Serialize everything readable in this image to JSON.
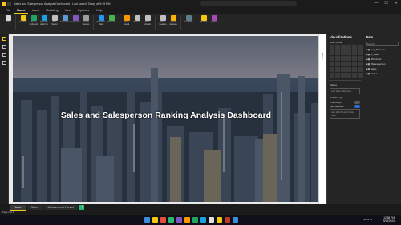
{
  "window": {
    "title": "Sales And Salesperson Analysis Dashboard • Last saved: Today at 9:45 PM",
    "controls": [
      "—",
      "☐",
      "✕"
    ]
  },
  "menu": {
    "tabs": [
      "File",
      "Home",
      "Insert",
      "Modeling",
      "View",
      "Optimize",
      "Help"
    ],
    "active": "Home"
  },
  "ribbon": {
    "buttons": [
      {
        "label": "Paste",
        "color": "#d9d9d9"
      },
      {
        "label": "Get data",
        "color": "#f2c811"
      },
      {
        "label": "Excel workbook",
        "color": "#21a366"
      },
      {
        "label": "OneLake data hub",
        "color": "#1aa1e0"
      },
      {
        "label": "SQL Server",
        "color": "#c0c0c0"
      },
      {
        "label": "Enter data",
        "color": "#5b9bd5"
      },
      {
        "label": "Dataverse",
        "color": "#7e57c2"
      },
      {
        "label": "Recent sources",
        "color": "#9e9e9e"
      },
      {
        "label": "Transform data",
        "color": "#2196f3"
      },
      {
        "label": "Refresh",
        "color": "#4caf50"
      },
      {
        "label": "New visual",
        "color": "#ff9800"
      },
      {
        "label": "Text box",
        "color": "#c0c0c0"
      },
      {
        "label": "More visuals",
        "color": "#c0c0c0"
      },
      {
        "label": "New measure",
        "color": "#c0c0c0"
      },
      {
        "label": "Quick measure",
        "color": "#ffb300"
      },
      {
        "label": "Sensitivity",
        "color": "#607d8b"
      },
      {
        "label": "Publish",
        "color": "#f2c811"
      },
      {
        "label": "Copilot",
        "color": "#ab47bc"
      }
    ]
  },
  "report": {
    "headline": "Sales and Salesperson Ranking Analysis Dashboard"
  },
  "filters": {
    "label": "Filters"
  },
  "visualizations": {
    "title": "Visualizations",
    "build_label": "Build visual",
    "values_label": "Values",
    "values_placeholder": "Add data fields here",
    "drillthrough_label": "Drill through",
    "cross_report_label": "Cross-report",
    "keep_filters_label": "Keep all filters",
    "drill_placeholder": "Add drill-through fields here"
  },
  "data_pane": {
    "title": "Data",
    "search_placeholder": "Search",
    "tables": [
      "Key_Measure",
      "dt_date",
      "dProducts",
      "dSalesperson",
      "Sales",
      "Target"
    ]
  },
  "pages": {
    "tabs": [
      "Home",
      "Sales",
      "Achievement Funnel"
    ],
    "active": "Home",
    "add_label": "+"
  },
  "status": {
    "page": "Page 1 of 3"
  },
  "taskbar": {
    "icon_colors": [
      "#3c8dde",
      "#f2c811",
      "#e84c3d",
      "#2bb673",
      "#7e57c2",
      "#ff9800",
      "#21a366",
      "#1aa1e0",
      "#e0e0e0",
      "#f2c811",
      "#c0392b",
      "#3c8dde"
    ],
    "tray": "ENG IN",
    "time": "12:58 PM",
    "date": "9/14/2024"
  }
}
